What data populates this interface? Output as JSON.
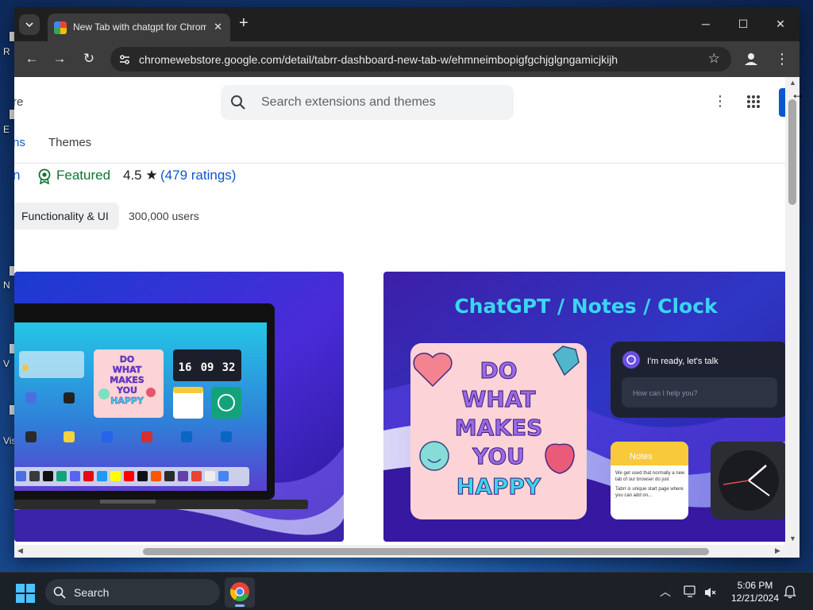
{
  "desktop": {
    "labels": [
      "R",
      "E",
      "N",
      "V",
      "Vis"
    ]
  },
  "browser": {
    "tab_title": "New Tab with chatgpt for Chrome",
    "url": "chromewebstore.google.com/detail/tabrr-dashboard-new-tab-w/ehmneimbopigfgchjglgngamicjkijh"
  },
  "store": {
    "logo_tail": "re",
    "search_placeholder": "Search extensions and themes",
    "tabs": [
      "ns",
      "Themes"
    ],
    "cut_link": "n",
    "featured": "Featured",
    "rating": "4.5",
    "rating_count": "(479 ratings)",
    "category": "Functionality & UI",
    "users": "300,000 users"
  },
  "screenshot1": {
    "sticker": [
      "DO",
      "WHAT",
      "MAKES",
      "YOU",
      "HAPPY"
    ],
    "clock": [
      "16",
      "09",
      "32"
    ]
  },
  "screenshot2": {
    "heading": "ChatGPT / Notes / Clock",
    "sticker": [
      "DO",
      "WHAT",
      "MAKES",
      "YOU",
      "HAPPY"
    ],
    "chat_title": "I'm ready, let's talk",
    "chat_placeholder": "How can I help you?",
    "notes_title": "Notes",
    "notes_text_1": "We get used that normally a new tab of our browser do just",
    "notes_text_2": "Tabrr is unique start page where you can add on..."
  },
  "taskbar": {
    "search_label": "Search",
    "time": "5:06 PM",
    "date": "12/21/2024"
  },
  "colors": {
    "accent": "#0b57d0",
    "featured_green": "#137333",
    "chrome_dark": "#1f1f1f",
    "toolbar": "#3c3c3c",
    "promo_purple": "#3d1fa8",
    "promo_cyan": "#3ad6f0",
    "sticker_pink": "#fcd3d6"
  },
  "icons": [
    "tab-search-icon",
    "favicon-icon",
    "close-icon",
    "plus-icon",
    "minimize-icon",
    "maximize-icon",
    "back-arrow-icon",
    "forward-arrow-icon",
    "reload-icon",
    "site-info-icon",
    "bookmark-star-icon",
    "profile-icon",
    "menu-dots-icon",
    "search-icon",
    "apps-grid-icon",
    "featured-badge-icon",
    "star-icon",
    "windows-start-icon",
    "chrome-icon",
    "chevron-up-icon",
    "network-icon",
    "bell-icon",
    "resize-cursor-icon"
  ]
}
